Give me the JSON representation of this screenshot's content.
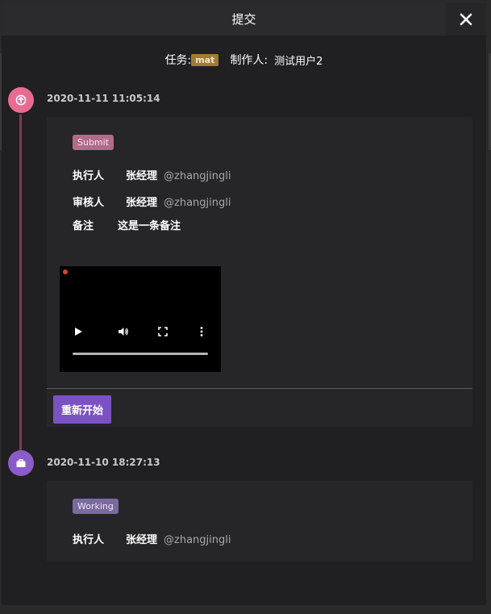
{
  "dialog": {
    "title": "提交"
  },
  "meta": {
    "task_label": "任务:",
    "task_tag": "mat",
    "maker_label": "制作人:",
    "maker_name": "测试用户2"
  },
  "timeline": [
    {
      "time": "2020-11-11 11:05:14",
      "status": "Submit",
      "executor_label": "执行人",
      "executor_name": "张经理",
      "executor_handle": "@zhangjingli",
      "reviewer_label": "审核人",
      "reviewer_name": "张经理",
      "reviewer_handle": "@zhangjingli",
      "note_label": "备注",
      "note_value": "这是一条备注",
      "restart_label": "重新开始"
    },
    {
      "time": "2020-11-10 18:27:13",
      "status": "Working",
      "executor_label": "执行人",
      "executor_name": "张经理",
      "executor_handle": "@zhangjingli"
    }
  ],
  "icons": {
    "close": "close-icon",
    "submit_dot": "arrow-up-circle-icon",
    "working_dot": "briefcase-icon",
    "play": "play-icon",
    "volume": "volume-icon",
    "fullscreen": "fullscreen-icon",
    "more": "more-vertical-icon"
  },
  "colors": {
    "submit_dot": "#e86b92",
    "working_dot": "#8a5cc8",
    "task_tag": "#a17a35",
    "submit_badge": "#b46b8b",
    "working_badge": "#7a6a9e",
    "restart_button": "#7b52c4",
    "timeline_line": "#7a3d55"
  }
}
